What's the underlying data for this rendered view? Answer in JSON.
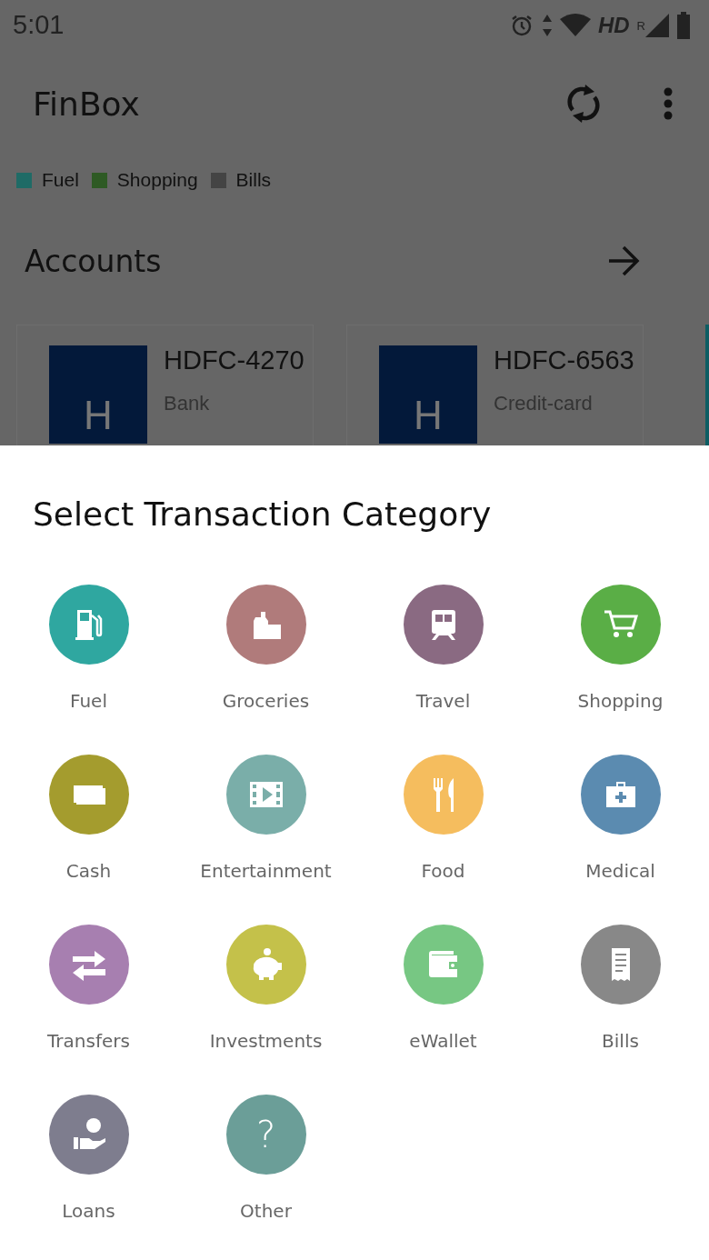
{
  "status_bar": {
    "time": "5:01",
    "network_label": "HD",
    "roaming_label": "R"
  },
  "app_bar": {
    "title": "FinBox"
  },
  "legend": [
    {
      "label": "Fuel",
      "color": "#1f6b66"
    },
    {
      "label": "Shopping",
      "color": "#2e5a24"
    },
    {
      "label": "Bills",
      "color": "#444444"
    }
  ],
  "accounts": {
    "title": "Accounts",
    "cards": [
      {
        "logo": "H",
        "name": "HDFC-4270",
        "type": "Bank"
      },
      {
        "logo": "H",
        "name": "HDFC-6563",
        "type": "Credit-card"
      }
    ]
  },
  "sheet": {
    "title": "Select Transaction Category",
    "categories": [
      {
        "label": "Fuel",
        "kind": "fuel",
        "color": "#2fa7a0"
      },
      {
        "label": "Groceries",
        "kind": "groceries",
        "color": "#b07b7b"
      },
      {
        "label": "Travel",
        "kind": "travel",
        "color": "#8a6a82"
      },
      {
        "label": "Shopping",
        "kind": "shopping",
        "color": "#5aae46"
      },
      {
        "label": "Cash",
        "kind": "cash",
        "color": "#a49c2e"
      },
      {
        "label": "Entertainment",
        "kind": "entertainment",
        "color": "#7aaea9"
      },
      {
        "label": "Food",
        "kind": "food",
        "color": "#f5bd5e"
      },
      {
        "label": "Medical",
        "kind": "medical",
        "color": "#5b8bb0"
      },
      {
        "label": "Transfers",
        "kind": "transfers",
        "color": "#a77fb0"
      },
      {
        "label": "Investments",
        "kind": "investments",
        "color": "#c4c14a"
      },
      {
        "label": "eWallet",
        "kind": "wallet",
        "color": "#77c783"
      },
      {
        "label": "Bills",
        "kind": "bills",
        "color": "#888888"
      },
      {
        "label": "Loans",
        "kind": "loans",
        "color": "#7e7d8e"
      },
      {
        "label": "Other",
        "kind": "other",
        "color": "#6b9e98",
        "glyph": "?"
      }
    ]
  }
}
